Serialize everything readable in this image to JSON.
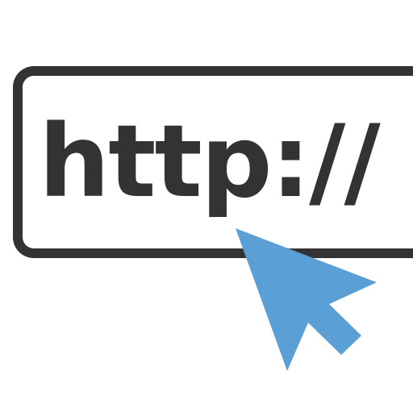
{
  "url_field": {
    "text": "http://"
  },
  "cursor": {
    "icon": "arrow-pointer-icon"
  },
  "colors": {
    "outline": "#333333",
    "cursor": "#5a9fd6",
    "background": "#ffffff"
  }
}
